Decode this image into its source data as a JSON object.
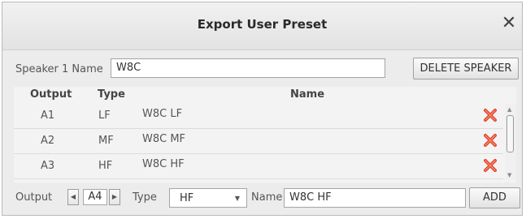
{
  "dialog": {
    "title": "Export User Preset"
  },
  "speaker": {
    "label": "Speaker 1 Name",
    "name_value": "W8C",
    "delete_label": "DELETE SPEAKER"
  },
  "table": {
    "headers": {
      "output": "Output",
      "type": "Type",
      "name": "Name"
    },
    "rows": [
      {
        "output": "A1",
        "type": "LF",
        "name": "W8C LF"
      },
      {
        "output": "A2",
        "type": "MF",
        "name": "W8C MF"
      },
      {
        "output": "A3",
        "type": "HF",
        "name": "W8C HF"
      }
    ],
    "delete_icon_color": "#e0402a"
  },
  "add_row": {
    "output_label": "Output",
    "output_value": "A4",
    "type_label": "Type",
    "type_value": "HF",
    "name_label": "Name",
    "name_value": "W8C HF",
    "add_label": "ADD"
  }
}
